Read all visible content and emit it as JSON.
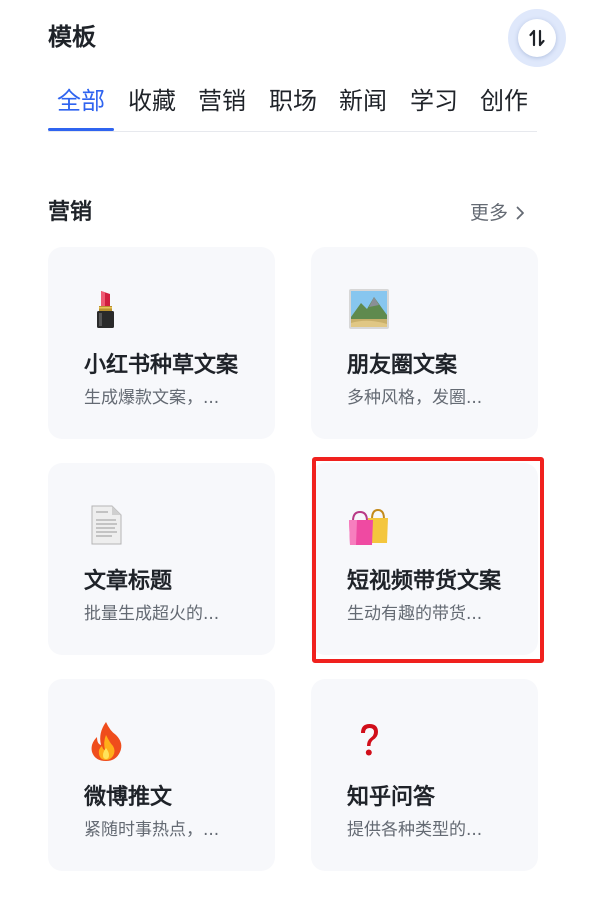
{
  "header": {
    "title": "模板",
    "sort_icon": "sort-toggle-icon"
  },
  "tabs": [
    {
      "label": "全部",
      "active": true
    },
    {
      "label": "收藏"
    },
    {
      "label": "营销"
    },
    {
      "label": "职场"
    },
    {
      "label": "新闻"
    },
    {
      "label": "学习"
    },
    {
      "label": "创作"
    }
  ],
  "section": {
    "title": "营销",
    "more_label": "更多"
  },
  "cards": [
    {
      "title": "小红书种草文案",
      "desc": "生成爆款文案，...",
      "icon": "lipstick-icon"
    },
    {
      "title": "朋友圈文案",
      "desc": "多种风格，发圈...",
      "icon": "landscape-photo-icon"
    },
    {
      "title": "文章标题",
      "desc": "批量生成超火的...",
      "icon": "document-icon"
    },
    {
      "title": "短视频带货文案",
      "desc": "生动有趣的带货...",
      "icon": "shopping-bags-icon"
    },
    {
      "title": "微博推文",
      "desc": "紧随时事热点，...",
      "icon": "fire-icon"
    },
    {
      "title": "知乎问答",
      "desc": "提供各种类型的...",
      "icon": "question-mark-icon"
    }
  ],
  "colors": {
    "accent": "#2f64f0",
    "highlight": "#f0211e",
    "card_bg": "#f7f8fb"
  }
}
